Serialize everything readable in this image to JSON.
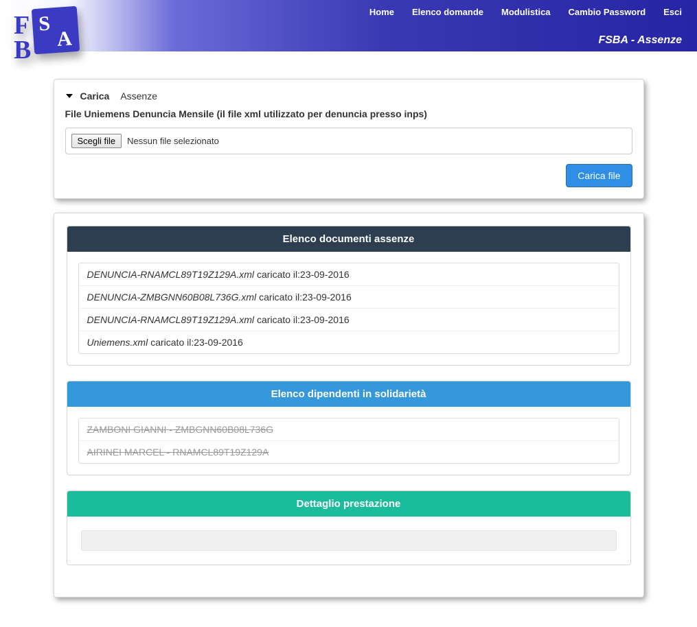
{
  "header": {
    "nav": {
      "home": "Home",
      "elenco": "Elenco domande",
      "modulistica": "Modulistica",
      "cambio": "Cambio Password",
      "esci": "Esci"
    },
    "page_title": "FSBA - Assenze"
  },
  "upload": {
    "carica": "Carica",
    "assenze": "Assenze",
    "description": "File Uniemens Denuncia Mensile (il file xml utilizzato per denuncia presso inps)",
    "choose_file_label": "Scegli file",
    "no_file": "Nessun file selezionato",
    "submit_label": "Carica file"
  },
  "documents": {
    "title": "Elenco documenti assenze",
    "items": [
      {
        "name": "DENUNCIA-RNAMCL89T19Z129A.xml",
        "date": "caricato il:23-09-2016"
      },
      {
        "name": "DENUNCIA-ZMBGNN60B08L736G.xml",
        "date": "caricato il:23-09-2016"
      },
      {
        "name": "DENUNCIA-RNAMCL89T19Z129A.xml",
        "date": "caricato il:23-09-2016"
      },
      {
        "name": "Uniemens.xml",
        "date": "caricato il:23-09-2016"
      }
    ]
  },
  "employees": {
    "title": "Elenco dipendenti in solidarietà",
    "items": [
      "ZAMBONI GIANNI - ZMBGNN60B08L736G",
      "AIRINEI MARCEL - RNAMCL89T19Z129A"
    ]
  },
  "detail": {
    "title": "Dettaglio prestazione"
  }
}
